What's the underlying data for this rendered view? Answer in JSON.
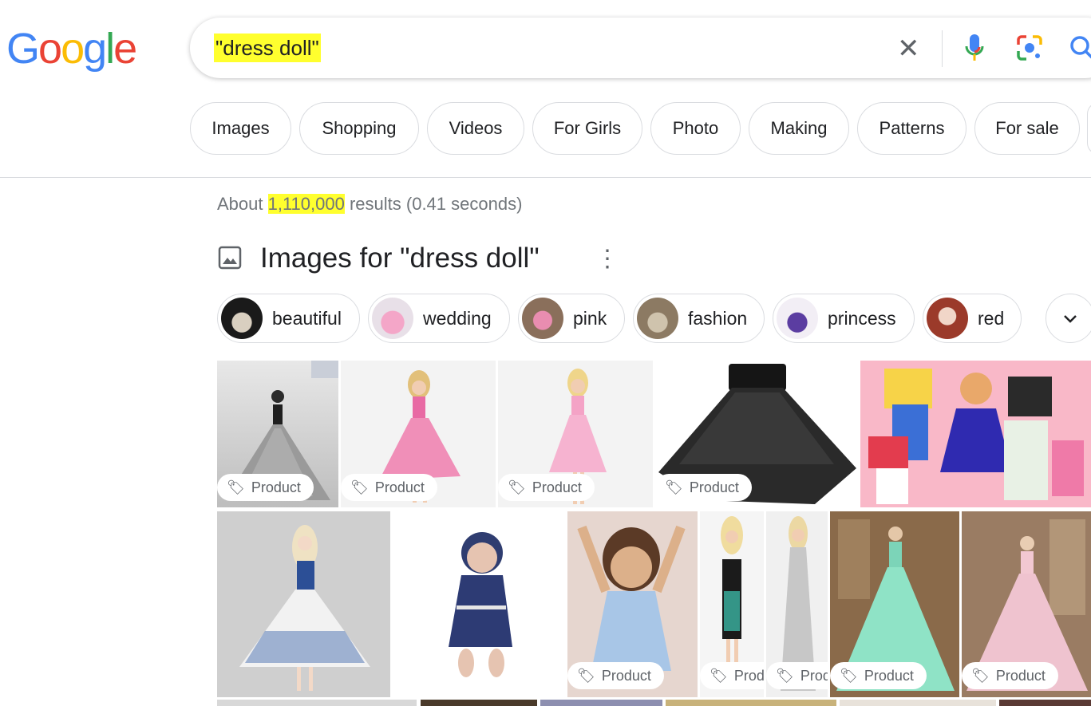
{
  "logo": {
    "letters": [
      "G",
      "o",
      "o",
      "g",
      "l",
      "e"
    ],
    "colors": [
      "#4285F4",
      "#EA4335",
      "#FBBC05",
      "#4285F4",
      "#34A853",
      "#EA4335"
    ]
  },
  "search": {
    "query": "\"dress doll\""
  },
  "filters": [
    "Images",
    "Shopping",
    "Videos",
    "For Girls",
    "Photo",
    "Making",
    "Patterns",
    "For sale"
  ],
  "stats": {
    "prefix": "About ",
    "count": "1,110,000",
    "suffix": " results (0.41 seconds)"
  },
  "images_section": {
    "title": "Images for \"dress doll\"",
    "refinements": [
      "beautiful",
      "wedding",
      "pink",
      "fashion",
      "princess",
      "red"
    ]
  },
  "badges": {
    "product": "Product",
    "produ": "Produ",
    "prod": "Prod"
  }
}
